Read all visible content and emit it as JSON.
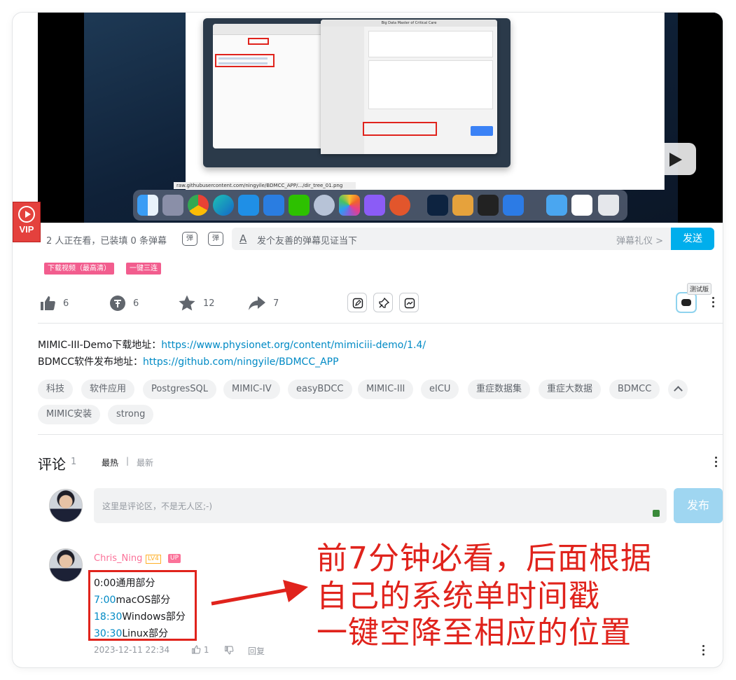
{
  "video": {
    "url_bar": "raw.githubusercontent.com/ningyile/BDMCC_APP/.../dir_tree_01.png",
    "app_title": "Big Data Master of Critical Care",
    "dock_apps": [
      "Finder",
      "Launchpad",
      "Chrome",
      "Edge",
      "Baidu Netdisk",
      "Aliyun Drive",
      "WeChat",
      "R",
      "Photos",
      "GitHub Desktop",
      "Remote Desktop",
      "Terminal Prompt",
      "Stack",
      "Terminal",
      "Teams"
    ]
  },
  "vip_badge": "VIP",
  "danmaku": {
    "viewers": "2 人正在看，已装填 0 条弹幕",
    "toggle1": "弹",
    "toggle2": "弹",
    "input_placeholder": "发个友善的弹幕见证当下",
    "etiquette": "弹幕礼仪 >",
    "send": "发送"
  },
  "pink_buttons": [
    "下载视频（最高清）",
    "一键三连"
  ],
  "toolbar": {
    "like_count": "6",
    "coin_count": "6",
    "fav_count": "12",
    "share_count": "7",
    "test_label": "测试版"
  },
  "description": {
    "line1_label": "MIMIC-III-Demo下载地址：",
    "line1_link": "https://www.physionet.org/content/mimiciii-demo/1.4/",
    "line2_label": "BDMCC软件发布地址：",
    "line2_link": "https://github.com/ningyile/BDMCC_APP"
  },
  "tags": [
    "科技",
    "软件应用",
    "PostgresSQL",
    "MIMIC-IV",
    "easyBDCC",
    "MIMIC-III",
    "eICU",
    "重症数据集",
    "重症大数据",
    "BDMCC",
    "MIMIC安装",
    "strong"
  ],
  "comments": {
    "title": "评论",
    "count": "1",
    "sort_hot": "最热",
    "sort_sep": "|",
    "sort_new": "最新",
    "input_placeholder": "这里是评论区，不是无人区;-)",
    "post": "发布",
    "item": {
      "user": "Chris_Ning",
      "level": "LV4",
      "up": "UP",
      "lines": [
        {
          "time": "0:00",
          "text": "通用部分"
        },
        {
          "time": "7:00",
          "text": "macOS部分"
        },
        {
          "time": "18:30",
          "text": "Windows部分"
        },
        {
          "time": "30:30",
          "text": "Linux部分"
        }
      ],
      "date": "2023-12-11 22:34",
      "likes": "1",
      "reply": "回复"
    }
  },
  "annotation": {
    "line1": "前7分钟必看，后面根据",
    "line2": "自己的系统单时间戳",
    "line3": "一键空降至相应的位置"
  },
  "colors": {
    "accent_blue": "#00aeec",
    "link_blue": "#008ac5",
    "pink": "#f25d8e",
    "annotation_red": "#e0231c"
  }
}
